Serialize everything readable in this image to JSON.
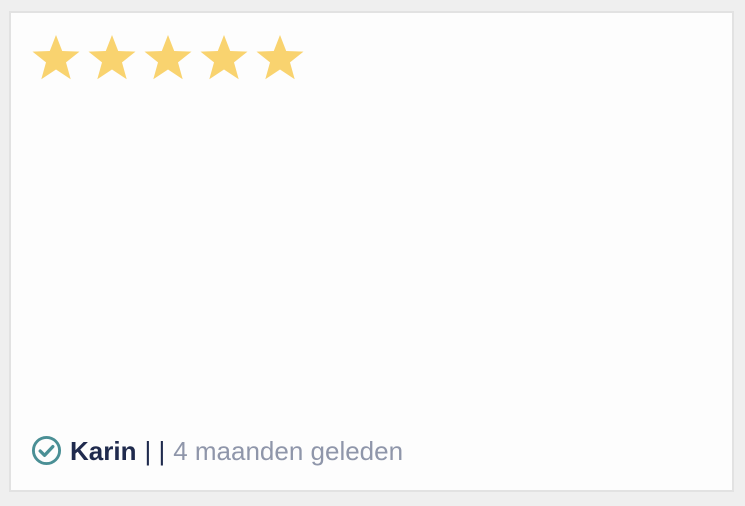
{
  "review": {
    "rating": 5,
    "max_rating": 5,
    "star_icon": "star-icon",
    "star_color": "#f9d36f",
    "verified_icon": "check-circle-icon",
    "verified_color": "#4a8f95",
    "author": "Karin",
    "separator": "| |",
    "time_ago": "4 maanden geleden"
  }
}
